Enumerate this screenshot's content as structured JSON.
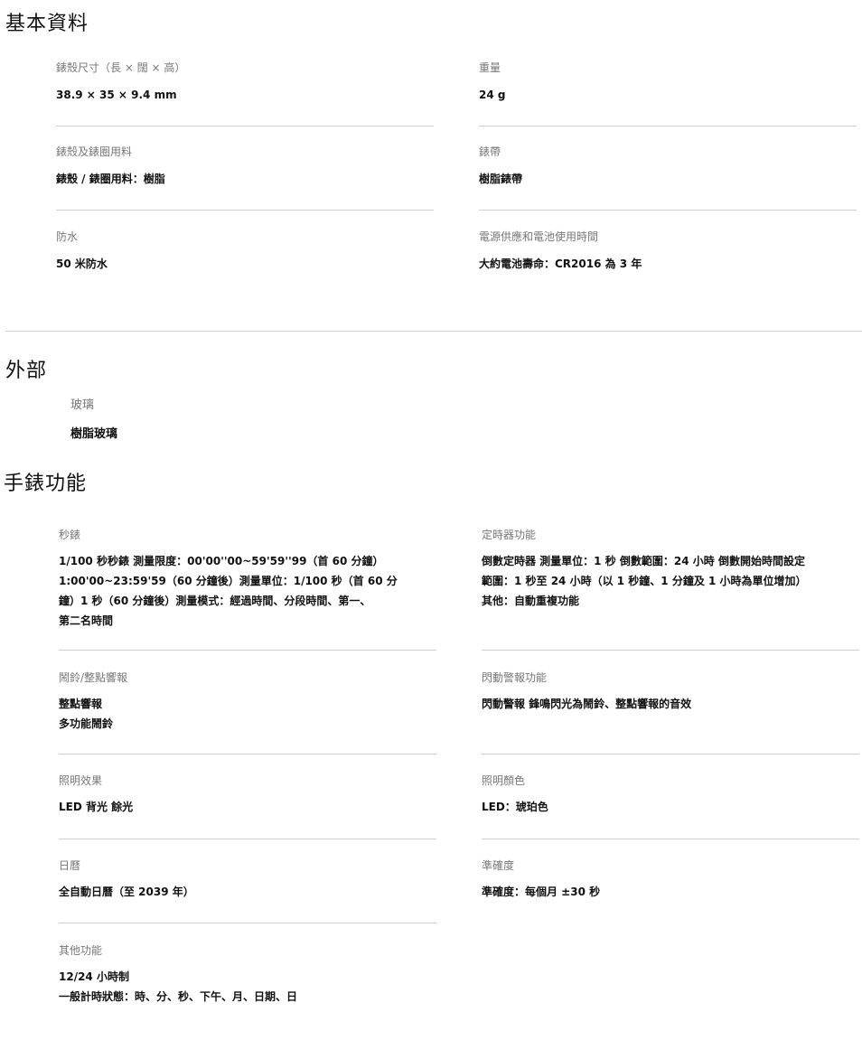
{
  "sections": {
    "basic": {
      "title": "基本資料",
      "items": [
        {
          "label": "錶殼尺寸（長 × 闊 × 高）",
          "value": "38.9 × 35 × 9.4 mm"
        },
        {
          "label": "重量",
          "value": "24 g"
        },
        {
          "label": "錶殼及錶圈用料",
          "value": "錶殼 / 錶圈用料：樹脂"
        },
        {
          "label": "錶帶",
          "value": "樹脂錶帶"
        },
        {
          "label": "防水",
          "value": "50 米防水"
        },
        {
          "label": "電源供應和電池使用時間",
          "value": "大約電池壽命：CR2016 為 3 年"
        }
      ]
    },
    "exterior": {
      "title": "外部",
      "items": [
        {
          "label": "玻璃",
          "value": "樹脂玻璃"
        }
      ]
    },
    "functions": {
      "title": "手錶功能",
      "items": [
        {
          "label": "秒錶",
          "lines": [
            "1/100 秒秒錶 測量限度：00'00''00~59'59''99（首 60 分鐘）",
            "1:00'00~23:59'59（60 分鐘後）測量單位：1/100 秒（首 60 分",
            "鐘）1 秒（60 分鐘後）測量模式：經過時間、分段時間、第一、",
            "第二名時間"
          ]
        },
        {
          "label": "定時器功能",
          "lines": [
            "倒數定時器 測量單位：1 秒 倒數範圍：24 小時 倒數開始時間設定",
            "範圍：1 秒至 24 小時（以 1 秒鐘、1 分鐘及 1 小時為單位增加）",
            "其他：自動重複功能"
          ]
        },
        {
          "label": "鬧鈴/整點響報",
          "lines": [
            "整點響報",
            "多功能鬧鈴"
          ]
        },
        {
          "label": "閃動警報功能",
          "lines": [
            "閃動警報 鋒鳴閃光為鬧鈴、整點響報的音效"
          ]
        },
        {
          "label": "照明效果",
          "lines": [
            "LED 背光 餘光"
          ]
        },
        {
          "label": "照明顏色",
          "lines": [
            "LED：琥珀色"
          ]
        },
        {
          "label": "日曆",
          "lines": [
            "全自動日曆（至 2039 年）"
          ]
        },
        {
          "label": "準確度",
          "lines": [
            "準確度：每個月 ±30 秒"
          ]
        },
        {
          "label": "其他功能",
          "lines": [
            "12/24 小時制",
            "一般計時狀態：時、分、秒、下午、月、日期、日"
          ]
        }
      ]
    }
  }
}
